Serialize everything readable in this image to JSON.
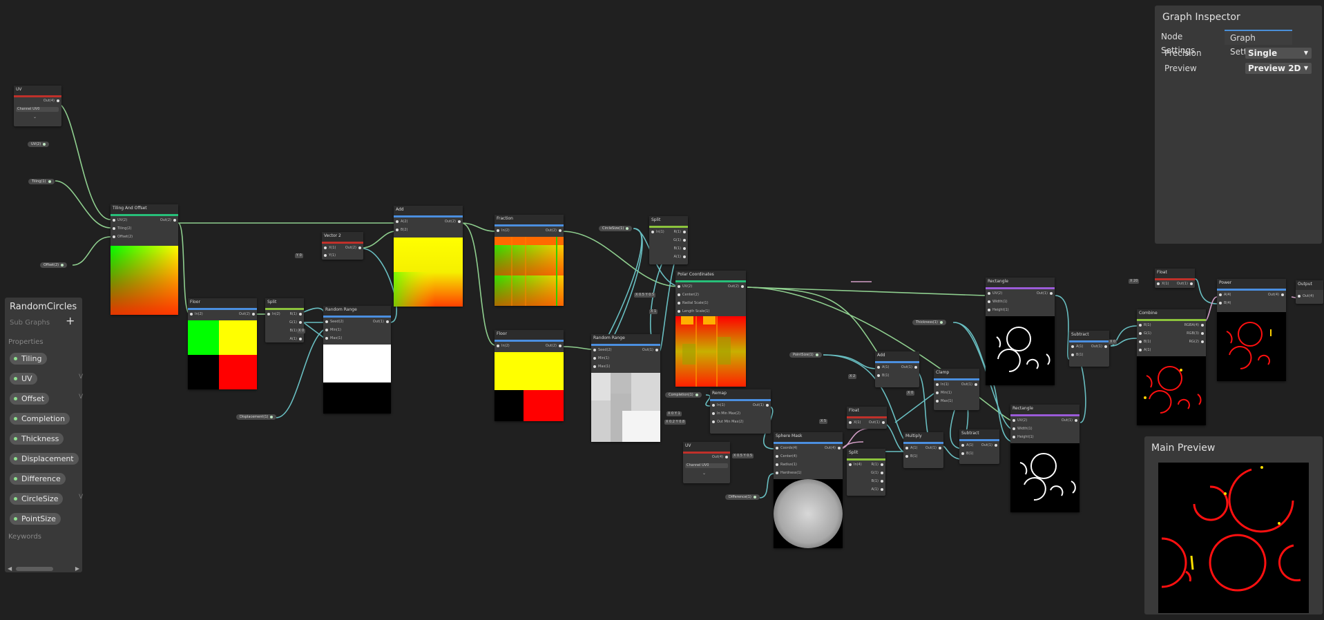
{
  "blackboard": {
    "title": "RandomCircles",
    "subtitle": "Sub Graphs",
    "add_label": "+",
    "properties_header": "Properties",
    "properties": [
      "Tiling",
      "UV",
      "Offset",
      "Completion",
      "Thickness",
      "Displacement",
      "Difference",
      "CircleSize",
      "PointSize"
    ],
    "keywords_header": "Keywords",
    "scroll_left": "◀",
    "scroll_right": "▶"
  },
  "inspector": {
    "title": "Graph Inspector",
    "tabs": {
      "node": "Node Settings",
      "graph": "Graph Settings"
    },
    "precision_label": "Precision",
    "precision_value": "Single",
    "preview_label": "Preview",
    "preview_value": "Preview 2D"
  },
  "main_preview": {
    "title": "Main Preview"
  },
  "graph": {
    "property_nodes": {
      "uv": "UV(2)",
      "tiling": "Tiling(1)",
      "offset": "Offset(2)",
      "circle_size": "CircleSize(1)",
      "displacement": "Displacement(1)",
      "completion": "Completion(1)",
      "thickness": "Thickness(1)",
      "point_size": "PointSize(1)",
      "difference": "Difference(1)"
    },
    "nodes": {
      "uv1": {
        "title": "UV",
        "out": "Out(4)",
        "channel_label": "Channel",
        "channel_value": "UV0"
      },
      "tiling_offset": {
        "title": "Tiling And Offset",
        "in": [
          "UV(2)",
          "Tiling(2)",
          "Offset(2)"
        ],
        "out": "Out(2)"
      },
      "floor1": {
        "title": "Floor",
        "in": [
          "In(2)"
        ],
        "out": "Out(2)"
      },
      "split1": {
        "title": "Split",
        "in": [
          "In(2)"
        ],
        "out": [
          "R(1)",
          "G(1)",
          "B(1)",
          "A(1)"
        ]
      },
      "vector2": {
        "title": "Vector 2",
        "in": [
          "X(1)",
          "Y(1)"
        ],
        "out": "Out(2)",
        "chip_y": "Y",
        "chip_y_val": "0"
      },
      "random_range1": {
        "title": "Random Range",
        "in": [
          "Seed(2)",
          "Min(1)",
          "Max(1)"
        ],
        "out": "Out(1)",
        "chip_x": "X",
        "chip_x_val": "0"
      },
      "add1": {
        "title": "Add",
        "in": [
          "A(2)",
          "B(2)"
        ],
        "out": "Out(2)"
      },
      "fraction": {
        "title": "Fraction",
        "in": [
          "In(2)"
        ],
        "out": "Out(2)"
      },
      "floor2": {
        "title": "Floor",
        "in": [
          "In(2)"
        ],
        "out": "Out(2)"
      },
      "split2": {
        "title": "Split",
        "in": [
          "In(1)"
        ],
        "out": [
          "R(1)",
          "G(1)",
          "B(1)",
          "A(1)"
        ]
      },
      "random_range2": {
        "title": "Random Range",
        "in": [
          "Seed(2)",
          "Min(1)",
          "Max(1)"
        ],
        "out": "Out(1)"
      },
      "polar": {
        "title": "Polar Coordinates",
        "in": [
          "UV(2)",
          "Center(2)",
          "Radial Scale(1)",
          "Length Scale(1)"
        ],
        "out": "Out(2)",
        "chip_center": [
          "X",
          "0.5",
          "Y",
          "0.5"
        ],
        "chip_rs": [
          "X",
          "1"
        ]
      },
      "remap": {
        "title": "Remap",
        "in": [
          "In(1)",
          "In Min Max(2)",
          "Out Min Max(2)"
        ],
        "out": "Out(1)",
        "chip_inmm": [
          "X",
          "0",
          "Y",
          "1"
        ],
        "chip_outmm": [
          "X",
          "0.2",
          "Y",
          "0.8"
        ]
      },
      "uv2": {
        "title": "UV",
        "out": "Out(4)",
        "channel_label": "Channel",
        "channel_value": "UV0"
      },
      "sphere_mask": {
        "title": "Sphere Mask",
        "in": [
          "Coords(4)",
          "Center(4)",
          "Radius(1)",
          "Hardness(1)"
        ],
        "out": "Out(4)",
        "chip_center": [
          "X",
          "0.5",
          "Y",
          "0.5",
          "Z",
          "0",
          "W",
          "0"
        ]
      },
      "float1": {
        "title": "Float",
        "in": [
          "X(1)"
        ],
        "out": "Out(1)",
        "chip": [
          "X",
          "5"
        ]
      },
      "split3": {
        "title": "Split",
        "in": [
          "In(4)"
        ],
        "out": [
          "R(1)",
          "G(1)",
          "B(1)",
          "A(1)"
        ]
      },
      "add2": {
        "title": "Add",
        "in": [
          "A(1)",
          "B(1)"
        ],
        "out": "Out(1)",
        "chip": [
          "X",
          "2"
        ]
      },
      "clamp": {
        "title": "Clamp",
        "in": [
          "In(1)",
          "Min(1)",
          "Max(1)"
        ],
        "out": "Out(1)",
        "chip": [
          "X",
          "0"
        ]
      },
      "multiply": {
        "title": "Multiply",
        "in": [
          "A(1)",
          "B(1)"
        ],
        "out": "Out(1)"
      },
      "subtract1": {
        "title": "Subtract",
        "in": [
          "A(1)",
          "B(1)"
        ],
        "out": "Out(1)"
      },
      "rect1": {
        "title": "Rectangle",
        "in": [
          "UV(2)",
          "Width(1)",
          "Height(1)"
        ],
        "out": "Out(1)"
      },
      "rect2": {
        "title": "Rectangle",
        "in": [
          "UV(2)",
          "Width(1)",
          "Height(1)"
        ],
        "out": "Out(1)"
      },
      "subtract2": {
        "title": "Subtract",
        "in": [
          "A(1)",
          "B(1)"
        ],
        "out": "Out(1)",
        "chip": [
          "X",
          "0"
        ]
      },
      "float2": {
        "title": "Float",
        "in": [
          "X(1)"
        ],
        "out": "Out(1)",
        "chip": [
          "X",
          "20"
        ]
      },
      "combine": {
        "title": "Combine",
        "in": [
          "R(1)",
          "G(1)",
          "B(1)",
          "A(1)"
        ],
        "out": [
          "RGBA(4)",
          "RGB(3)",
          "RG(2)"
        ]
      },
      "power": {
        "title": "Power",
        "in": [
          "A(4)",
          "B(4)"
        ],
        "out": "Out(4)"
      },
      "output": {
        "title": "Output",
        "in": [
          "Out(4)"
        ]
      }
    }
  },
  "colors": {
    "canvas": "#202020",
    "header_uv": "#c0302a",
    "header_math": "#4b8fe0",
    "header_split": "#8cc43c",
    "header_uvnode": "#27c07a",
    "header_procedural": "#9b5bd9",
    "wire_vec2": "#8fd79a",
    "wire_float": "#6ec1c4"
  }
}
